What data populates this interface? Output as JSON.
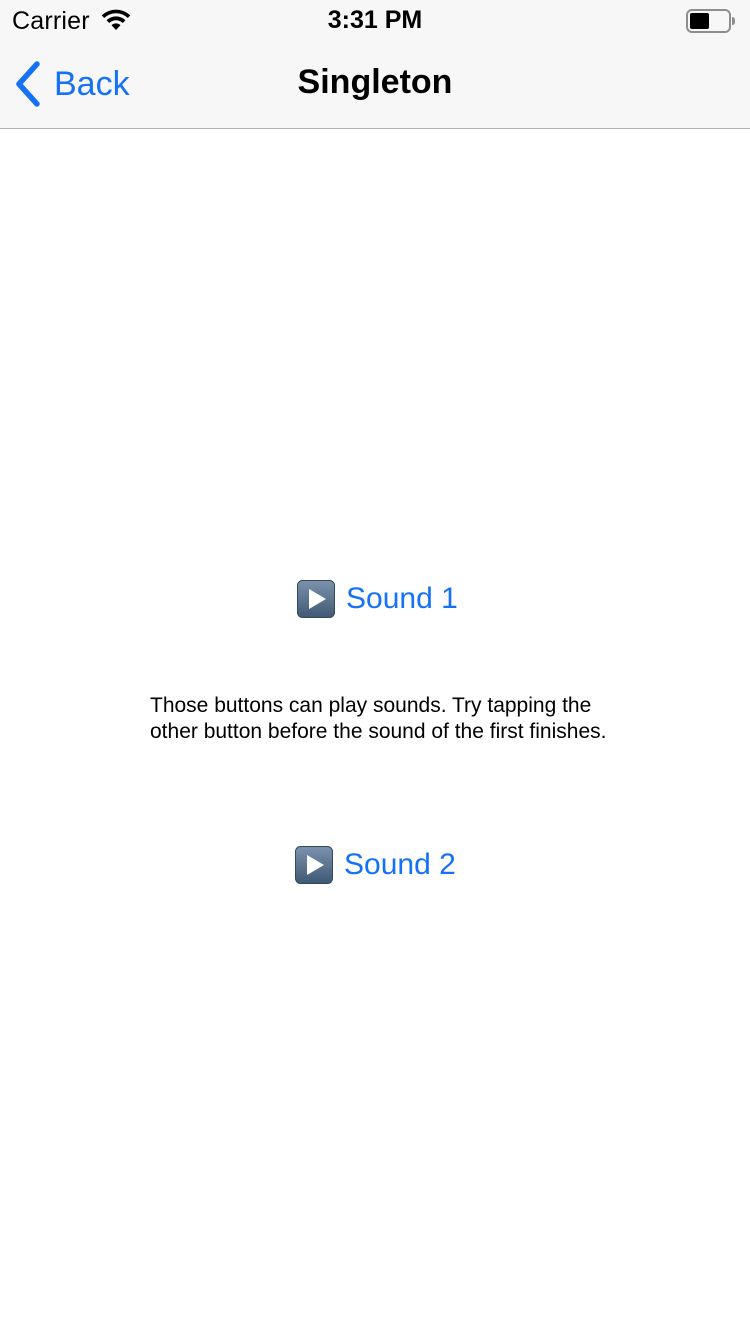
{
  "status_bar": {
    "carrier": "Carrier",
    "time": "3:31 PM",
    "icons": [
      "wifi-icon",
      "battery-icon"
    ]
  },
  "nav_bar": {
    "back_label": "Back",
    "title": "Singleton",
    "back_icon": "chevron-left-icon"
  },
  "content": {
    "sound1_label": "Sound 1",
    "sound2_label": "Sound 2",
    "play_icon": "play-icon",
    "info_text": "Those buttons can play sounds. Try tapping the other button before the sound of the first finishes."
  },
  "colors": {
    "accent": "#1571f5",
    "bar_background": "#f7f7f7",
    "play_icon_fill": "#5a7593"
  }
}
